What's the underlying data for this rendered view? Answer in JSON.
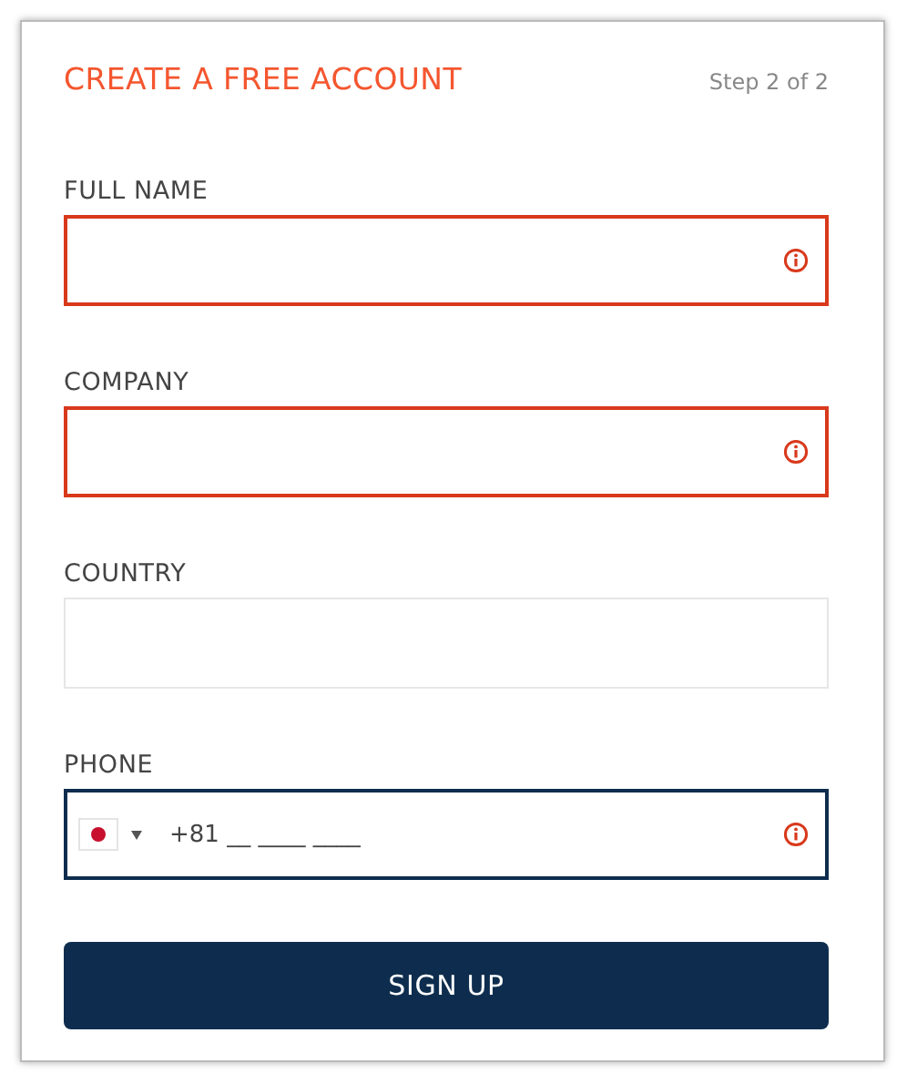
{
  "header": {
    "title": "CREATE A FREE ACCOUNT",
    "step": "Step 2 of 2"
  },
  "fields": [
    {
      "kind": "text",
      "label": "FULL NAME",
      "invalid": true,
      "focused": false
    },
    {
      "kind": "text",
      "label": "COMPANY",
      "invalid": true,
      "focused": false
    },
    {
      "kind": "text",
      "label": "COUNTRY",
      "invalid": false,
      "focused": false
    },
    {
      "kind": "phone",
      "label": "PHONE",
      "invalid": true,
      "focused": true,
      "value": "+81 __ ____ ____"
    }
  ],
  "submit": "SIGN UP"
}
